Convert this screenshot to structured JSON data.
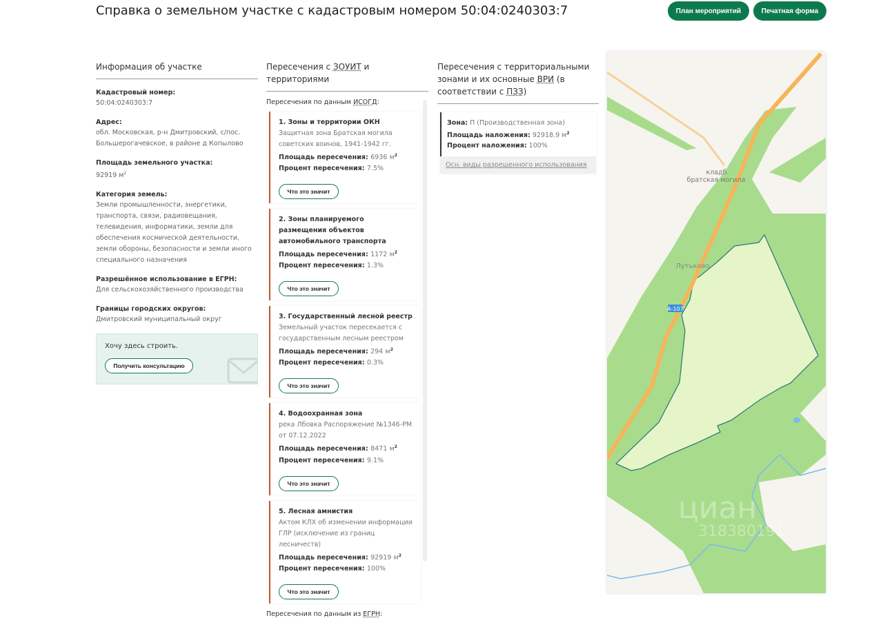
{
  "header": {
    "title": "Справка о земельном участке с кадастровым номером 50:04:0240303:7",
    "btn_plan": "План мероприятий",
    "btn_print": "Печатная форма"
  },
  "info": {
    "heading": "Информация об участке",
    "fields": [
      {
        "label": "Кадастровый номер:",
        "value": "50:04:0240303:7"
      },
      {
        "label": "Адрес:",
        "value": "обл. Московская, р-н Дмитровский, с/пос. Большерогачевское, в районе д Копылово"
      },
      {
        "label": "Площадь земельного участка:",
        "value": "92919 м",
        "sup": "2"
      },
      {
        "label": "Категория земель:",
        "value": "Земли промышленности, энергетики, транспорта, связи, радиовещания, телевидения, информатики, земли для обеспечения космической деятельности, земли обороны, безопасности и земли иного специального назначения"
      },
      {
        "label": "Разрешённое использование в ЕГРН:",
        "value": "Для сельскохозяйственного производства"
      },
      {
        "label": "Границы городских округов:",
        "value": "Дмитровский муниципальный округ"
      }
    ],
    "promo_text": "Хочу здесь строить.",
    "promo_button": "Получить консультацию"
  },
  "zouit": {
    "heading_pre": "Пересечения с ",
    "heading_abbr": "ЗОУИТ",
    "heading_post": " и территориями",
    "isogd_pre": "Пересечения по данным ",
    "isogd_abbr": "ИСОГД",
    "isogd_post": ":",
    "area_label": "Площадь пересечения:",
    "pct_label": "Процент пересечения:",
    "unit": "м",
    "sup": "2",
    "button": "Что это значит",
    "cards": [
      {
        "title": "1. Зоны и территории ОКН",
        "desc": "Защитная зона Братская могила советских воинов, 1941-1942 гг.",
        "area": "6936",
        "pct": "7.5%"
      },
      {
        "title": "2. Зоны планируемого размещения объектов автомобильного транспорта",
        "desc": "",
        "area": "1172",
        "pct": "1.3%"
      },
      {
        "title": "3. Государственный лесной реестр",
        "desc": "Земельный участок пересекается с государственным лесным реестром",
        "area": "294",
        "pct": "0.3%"
      },
      {
        "title": "4. Водоохранная зона",
        "desc": "река Лбовка Распоряжение №1346-РМ от 07.12.2022",
        "area": "8471",
        "pct": "9.1%"
      },
      {
        "title": "5. Лесная амнистия",
        "desc": "Актом КЛХ об изменении информации ГЛР (исключение из границ лесничеств)",
        "area": "92919",
        "pct": "100%"
      }
    ],
    "egrn_pre": "Пересечения по данным из ",
    "egrn_abbr": "ЕГРН",
    "egrn_post": ":"
  },
  "pzz": {
    "heading_pre": "Пересечения с территориальными зонами и их основные ",
    "heading_abbr1": "ВРИ",
    "heading_mid": " (в соответствии с ",
    "heading_abbr2": "ПЗЗ",
    "heading_post": ")",
    "zone_label": "Зона:",
    "zone_value": " П (Производственная зона)",
    "area_label": "Площадь наложения:",
    "area_value": " 92918.9 м",
    "sup": "2",
    "pct_label": "Процент наложения:",
    "pct_value": " 100%",
    "link": "Осн. виды разрешенного использования"
  },
  "map": {
    "label_cemetery1": "кладб.",
    "label_cemetery2": "братская могила",
    "label_village": "Лутьково",
    "road_badge": "А-107",
    "watermark": "циан",
    "watermark_id": "318380191",
    "colors": {
      "forest": "#a8dc8c",
      "plot": "#e6f5c8",
      "road": "#f5b55a",
      "bg": "#f6f4ef",
      "water": "#7ab8ee",
      "outline": "#2e7d72"
    }
  }
}
